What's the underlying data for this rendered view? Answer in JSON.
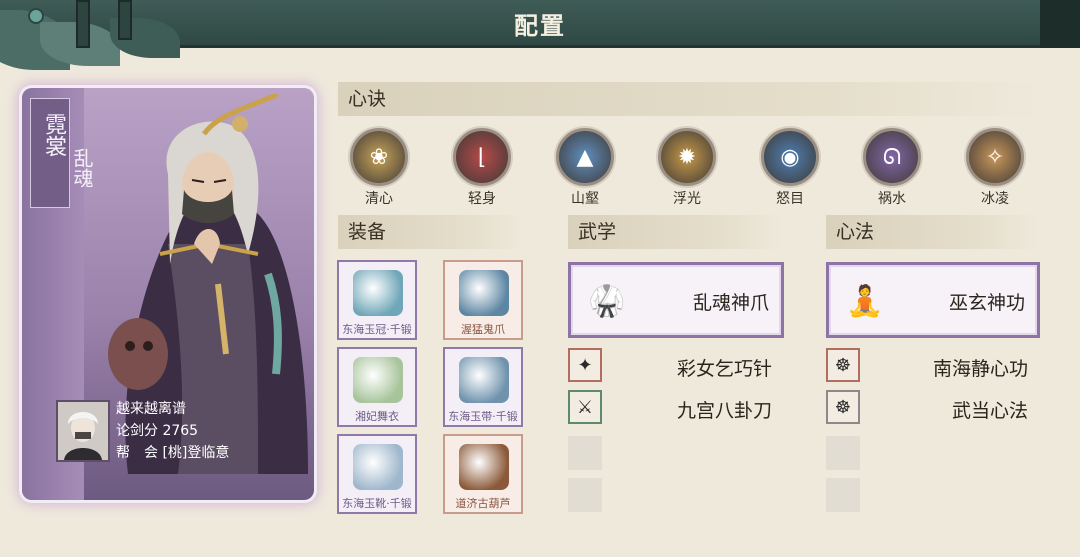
{
  "header": {
    "title": "配置"
  },
  "character": {
    "name_main": "霓裳",
    "name_sub": "乱魂",
    "player_name": "越来越离谱",
    "score_label": "论剑分",
    "score_value": "2765",
    "guild_label": "帮　会",
    "guild_value": "[桃]登临意"
  },
  "sections": {
    "xinjue": "心诀",
    "equipment": "装备",
    "wuxue": "武学",
    "xinfa": "心法"
  },
  "skills": [
    {
      "label": "清心",
      "icon": "lotus-icon",
      "color": "#c9a45a"
    },
    {
      "label": "轻身",
      "icon": "boot-icon",
      "color": "#b54a4a"
    },
    {
      "label": "山壑",
      "icon": "mountain-icon",
      "color": "#5f8fc0"
    },
    {
      "label": "浮光",
      "icon": "sun-icon",
      "color": "#c79a4a"
    },
    {
      "label": "怒目",
      "icon": "eye-icon",
      "color": "#4e7fb3"
    },
    {
      "label": "祸水",
      "icon": "tentacle-icon",
      "color": "#8466a8"
    },
    {
      "label": "冰凌",
      "icon": "crystal-icon",
      "color": "#c9975a"
    }
  ],
  "equipment": [
    {
      "name": "东海玉冠·千锻",
      "icon": "helmet-icon",
      "tone": "purple",
      "color": "#6fa6b8"
    },
    {
      "name": "渥猛鬼爪",
      "icon": "gauntlet-icon",
      "tone": "orange",
      "color": "#5d86a3"
    },
    {
      "name": "湘妃舞衣",
      "icon": "robe-icon",
      "tone": "purple",
      "color": "#a7c49a"
    },
    {
      "name": "东海玉带·千锻",
      "icon": "belt-icon",
      "tone": "purple",
      "color": "#6f93ad"
    },
    {
      "name": "东海玉靴·千锻",
      "icon": "boots-icon",
      "tone": "purple",
      "color": "#9fb7cc"
    },
    {
      "name": "道济古葫芦",
      "icon": "gourd-icon",
      "tone": "orange",
      "color": "#8c5a3a"
    }
  ],
  "wuxue": {
    "main": {
      "name": "乱魂神爪",
      "icon": "martial-artist-icon"
    },
    "list": [
      {
        "name": "彩女乞巧针",
        "icon": "needle-icon",
        "tone": "red"
      },
      {
        "name": "九宫八卦刀",
        "icon": "blade-icon",
        "tone": "green"
      }
    ]
  },
  "xinfa": {
    "main": {
      "name": "巫玄神功",
      "icon": "meditation-icon"
    },
    "list": [
      {
        "name": "南海静心功",
        "icon": "buddha-icon",
        "tone": "red"
      },
      {
        "name": "武当心法",
        "icon": "buddha-icon",
        "tone": "gray"
      }
    ]
  }
}
